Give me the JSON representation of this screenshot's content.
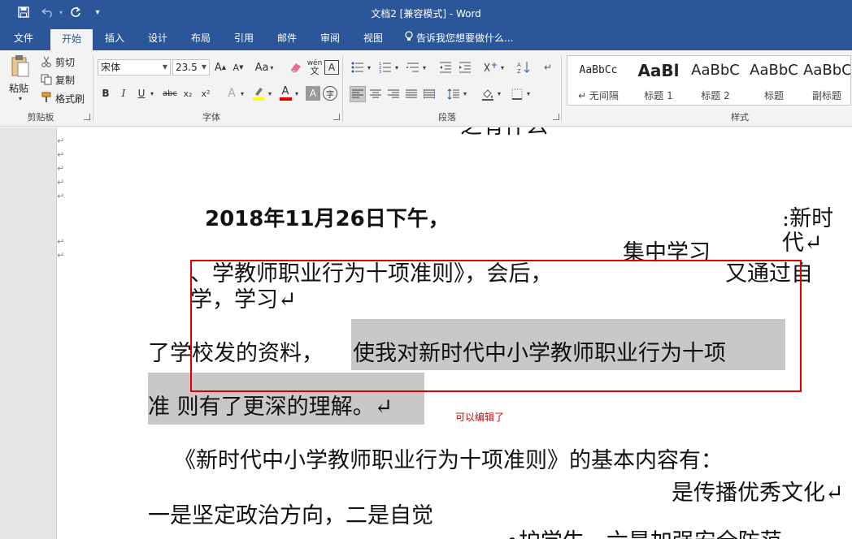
{
  "window": {
    "title": "文档2 [兼容模式] - Word"
  },
  "tabs": [
    {
      "label": "文件"
    },
    {
      "label": "开始"
    },
    {
      "label": "插入"
    },
    {
      "label": "设计"
    },
    {
      "label": "布局"
    },
    {
      "label": "引用"
    },
    {
      "label": "邮件"
    },
    {
      "label": "审阅"
    },
    {
      "label": "视图"
    }
  ],
  "tell_me": "告诉我您想要做什么...",
  "clipboard": {
    "paste": "粘贴",
    "cut": "剪切",
    "copy": "复制",
    "format_painter": "格式刷",
    "group_label": "剪贴板"
  },
  "font": {
    "name": "宋体",
    "size": "23.5",
    "change_case": "Aa",
    "group_label": "字体",
    "bold": "B",
    "italic": "I",
    "underline": "U",
    "strike": "abc",
    "subscript": "x₂",
    "superscript": "x²"
  },
  "paragraph": {
    "group_label": "段落"
  },
  "styles": {
    "group_label": "样式",
    "items": [
      {
        "sample": "AaBbCc",
        "name": "↵ 无间隔"
      },
      {
        "sample": "AaBl",
        "name": "标题 1"
      },
      {
        "sample": "AaBbC",
        "name": "标题 2"
      },
      {
        "sample": "AaBbC",
        "name": "标题"
      },
      {
        "sample": "AaBbC",
        "name": "副标题"
      }
    ]
  },
  "document": {
    "top_fragment": "之有什么",
    "line1_date": "2018年11月26日下午，",
    "line1_right": ":新时",
    "line1_right2": "代↵",
    "line2_above": "集中学习",
    "line2_left": "、学教师职业行为十项准则》，会后，",
    "line2_right": "又通过自",
    "line3": "学，学习↵",
    "line4_a": "了学校发的资料，",
    "line4_b": "使我对新时代中小学教师职业行为十项",
    "line5": "准 则有了更深的理解。↵",
    "line6": "《新时代中小学教师职业行为十项准则》的基本内容有：",
    "line7_right": "是传播优秀文化↵",
    "line8": "一是坚定政治方向，二是自觉",
    "line9_partial": "•护学生，六是加强安全防范"
  },
  "annotation": {
    "note": "可以编辑了",
    "box_color": "#e00000"
  },
  "colors": {
    "titlebar": "#2b579a",
    "ribbon": "#f3f3f3",
    "highlight": "#c8c8c8"
  }
}
